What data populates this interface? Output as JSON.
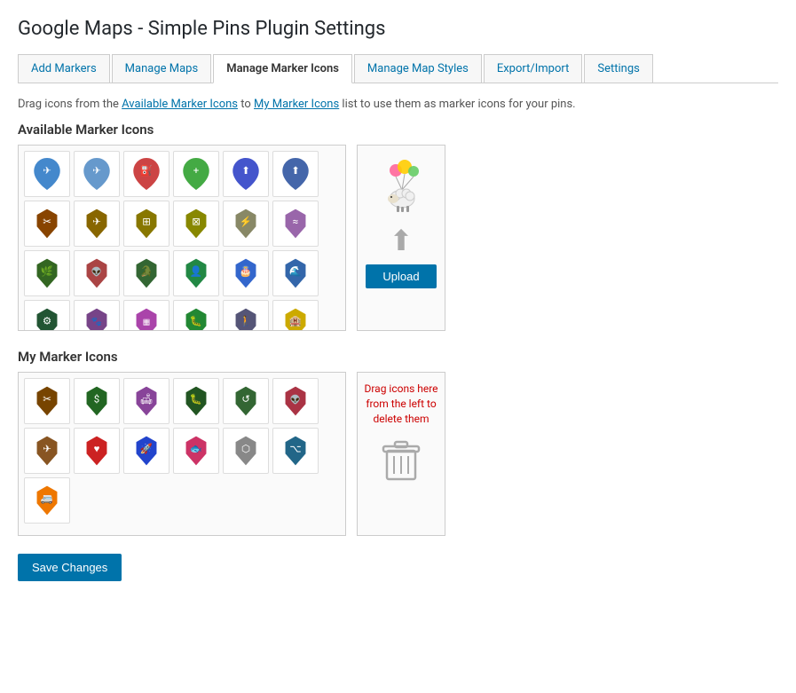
{
  "page": {
    "title": "Google Maps - Simple Pins Plugin Settings"
  },
  "tabs": [
    {
      "id": "add-markers",
      "label": "Add Markers",
      "active": false
    },
    {
      "id": "manage-maps",
      "label": "Manage Maps",
      "active": false
    },
    {
      "id": "manage-marker-icons",
      "label": "Manage Marker Icons",
      "active": true
    },
    {
      "id": "manage-map-styles",
      "label": "Manage Map Styles",
      "active": false
    },
    {
      "id": "export-import",
      "label": "Export/Import",
      "active": false
    },
    {
      "id": "settings",
      "label": "Settings",
      "active": false
    }
  ],
  "instruction": {
    "text_before": "Drag icons from the ",
    "link1": "Available Marker Icons",
    "text_middle": " to ",
    "link2": "My Marker Icons",
    "text_after": " list to use them as marker icons for your pins."
  },
  "available_section": {
    "title": "Available Marker Icons"
  },
  "my_section": {
    "title": "My Marker Icons"
  },
  "upload_btn_label": "Upload",
  "save_btn_label": "Save Changes",
  "delete_text": "Drag icons here from the left to delete them"
}
